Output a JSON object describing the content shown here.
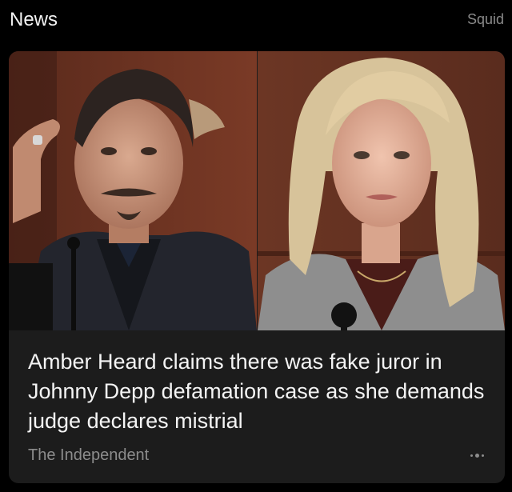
{
  "header": {
    "title": "News",
    "source": "Squid"
  },
  "article": {
    "headline": "Amber Heard claims there was fake juror in Johnny Depp defamation case as she demands judge declares mistrial",
    "publisher": "The Independent",
    "more_icon": "more-dots-icon"
  },
  "colors": {
    "background": "#000000",
    "card": "#1c1c1c",
    "headline_text": "#f4f4f4",
    "secondary_text": "#8c8c8c"
  }
}
